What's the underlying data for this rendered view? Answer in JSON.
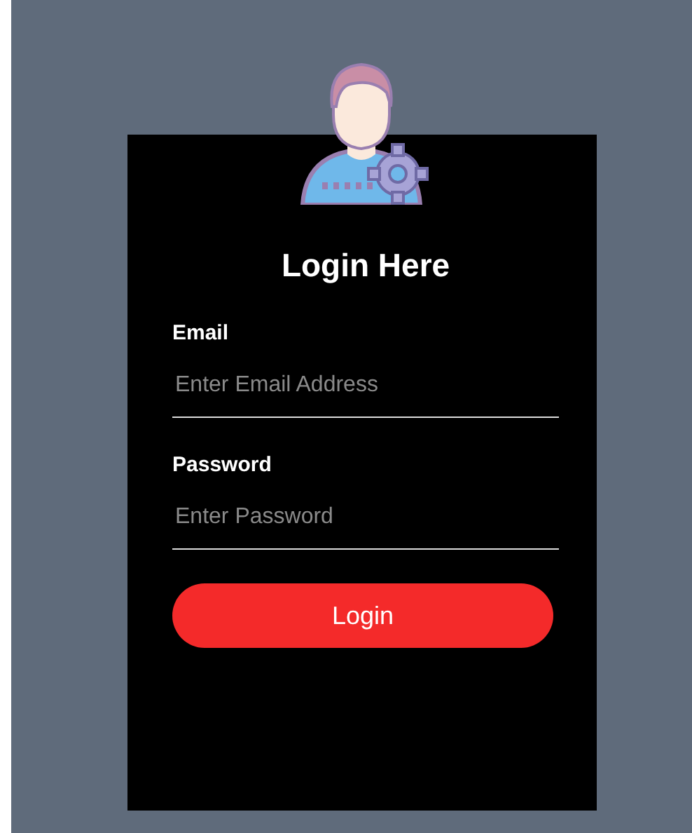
{
  "title": "Login Here",
  "fields": [
    {
      "label": "Email",
      "placeholder": "Enter Email Address"
    },
    {
      "label": "Password",
      "placeholder": "Enter Password"
    }
  ],
  "button": "Login"
}
